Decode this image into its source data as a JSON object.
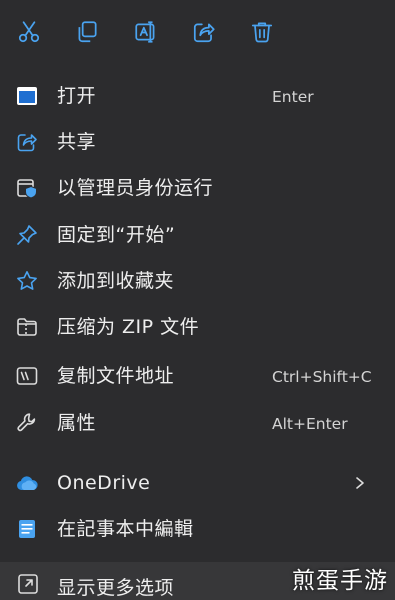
{
  "toolbar": {
    "buttons": [
      {
        "icon": "cut-icon"
      },
      {
        "icon": "copy-icon"
      },
      {
        "icon": "rename-icon"
      },
      {
        "icon": "share-icon"
      },
      {
        "icon": "delete-icon"
      }
    ]
  },
  "menu": {
    "items": [
      {
        "label": "打开",
        "shortcut": "Enter",
        "icon": "open-window-icon"
      },
      {
        "label": "共享",
        "icon": "share-icon"
      },
      {
        "label": "以管理员身份运行",
        "icon": "shield-icon"
      },
      {
        "label": "固定到“开始”",
        "icon": "pin-icon"
      },
      {
        "label": "添加到收藏夹",
        "icon": "star-icon"
      },
      {
        "label": "压缩为 ZIP 文件",
        "icon": "zip-folder-icon"
      },
      {
        "label": "复制文件地址",
        "shortcut": "Ctrl+Shift+C",
        "icon": "path-copy-icon"
      },
      {
        "label": "属性",
        "shortcut": "Alt+Enter",
        "icon": "wrench-icon"
      },
      {
        "label": "OneDrive",
        "icon": "cloud-icon",
        "submenu": true
      },
      {
        "label": "在記事本中編輯",
        "icon": "notepad-icon"
      }
    ],
    "more_options": {
      "label": "显示更多选项",
      "icon": "more-options-icon"
    }
  },
  "watermark": "煎蛋手游",
  "colors": {
    "background": "#2c2c2e",
    "accent_blue": "#4aa3f0",
    "icon_stroke": "#dcdcdc",
    "onedrive_blue": "#2f8ee0"
  }
}
